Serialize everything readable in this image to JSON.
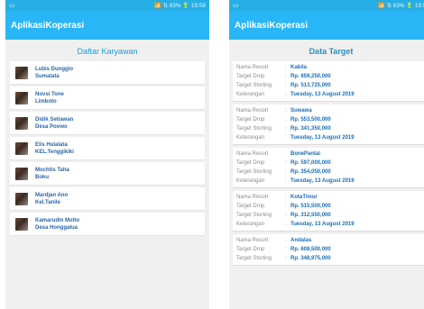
{
  "status": {
    "left_icon": "▭",
    "right_text": "📶 ⇅ 63% 🔋 19:58"
  },
  "left_screen": {
    "app_title": "AplikasiKoperasi",
    "page_title": "Daftar Karyawan",
    "employees": [
      {
        "name": "Lubis Dunggio",
        "place": "Sumalata"
      },
      {
        "name": "Novsi Tone",
        "place": "Limboto"
      },
      {
        "name": "Didik Setiawan",
        "place": "Desa Poowo"
      },
      {
        "name": "Elis Hulalata",
        "place": "KEL.Tenggikiki"
      },
      {
        "name": "Mochtis Taha",
        "place": "Boku"
      },
      {
        "name": "Mardjan Ano",
        "place": "Kel.Tanile"
      },
      {
        "name": "Kamarudin Molto",
        "place": "Desa Honggalua"
      }
    ]
  },
  "right_screen": {
    "app_title": "AplikasiKoperasi",
    "page_title": "Data Target",
    "labels": {
      "resort": "Nama Resort",
      "drop": "Target Drop",
      "storting": "Target Storting",
      "note": "Keterangan",
      "sep": ":"
    },
    "targets": [
      {
        "resort": "Kabila",
        "drop": "Rp. 859,250,000",
        "storting": "Rp. 513,725,000",
        "note": "Tuesday, 13 August 2019"
      },
      {
        "resort": "Suwawa",
        "drop": "Rp. 553,500,000",
        "storting": "Rp. 341,350,000",
        "note": "Tuesday, 13 August 2019"
      },
      {
        "resort": "BonePantai",
        "drop": "Rp. 597,000,000",
        "storting": "Rp. 354,050,000",
        "note": "Tuesday, 13 August 2019"
      },
      {
        "resort": "KotaTimur",
        "drop": "Rp. 515,500,000",
        "storting": "Rp. 312,550,000",
        "note": "Tuesday, 13 August 2019"
      },
      {
        "resort": "Andalas",
        "drop": "Rp. 608,500,000",
        "storting": "Rp. 348,975,000",
        "note": ""
      }
    ]
  }
}
